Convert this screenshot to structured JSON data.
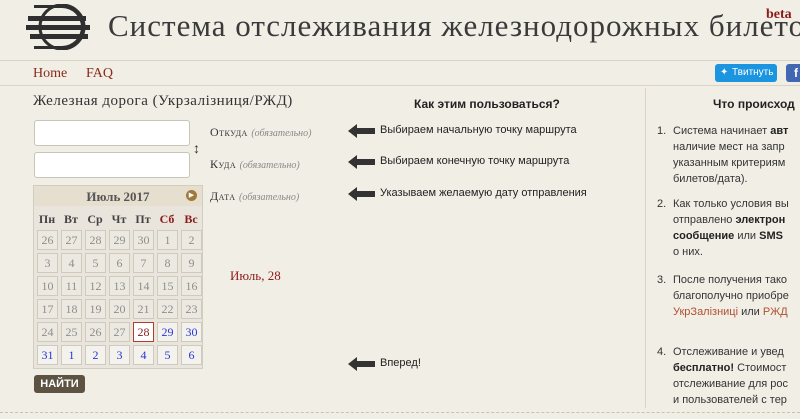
{
  "header": {
    "site_title": "Система отслеживания железнодорожных билетов",
    "beta": "beta"
  },
  "nav": {
    "home": "Home",
    "faq": "FAQ",
    "tweet": "Твитнуть",
    "facebook": "f"
  },
  "form": {
    "railway_title": "Железная дорога (Укрзалізниця/РЖД)",
    "from_value": "",
    "to_value": "",
    "from_label": "Откуда",
    "to_label": "Куда",
    "date_label": "Дата",
    "required": "(обязательно)",
    "selected_date": "Июль, 28",
    "find_button": "НАЙТИ"
  },
  "calendar": {
    "month": "Июль 2017",
    "weekdays": [
      "Пн",
      "Вт",
      "Ср",
      "Чт",
      "Пт",
      "Сб",
      "Вс"
    ],
    "weeks": [
      [
        "26",
        "27",
        "28",
        "29",
        "30",
        "1",
        "2"
      ],
      [
        "3",
        "4",
        "5",
        "6",
        "7",
        "8",
        "9"
      ],
      [
        "10",
        "11",
        "12",
        "13",
        "14",
        "15",
        "16"
      ],
      [
        "17",
        "18",
        "19",
        "20",
        "21",
        "22",
        "23"
      ],
      [
        "24",
        "25",
        "26",
        "27",
        "28",
        "29",
        "30"
      ],
      [
        "31",
        "1",
        "2",
        "3",
        "4",
        "5",
        "6"
      ]
    ],
    "today": "28",
    "available_color": "#2a36d6",
    "today_color": "#8b1a1a"
  },
  "how_to": {
    "heading": "Как этим пользоваться?",
    "hints": [
      "Выбираем начальную точку маршрута",
      "Выбираем конечную точку маршрута",
      "Указываем желаемую дату отправления",
      "Вперед!"
    ]
  },
  "what_happens": {
    "heading": "Что происход",
    "steps": [
      {
        "num": "1.",
        "lines": [
          [
            "Система начинает ",
            "авт"
          ],
          [
            "наличие мест на запр"
          ],
          [
            "указанным критериям"
          ],
          [
            "билетов/дата)."
          ]
        ]
      },
      {
        "num": "2.",
        "lines": [
          [
            "Как только условия вы"
          ],
          [
            "отправлено ",
            "электрон"
          ],
          [
            "сообщение",
            " или ",
            "SMS"
          ],
          [
            "о них."
          ]
        ]
      },
      {
        "num": "3.",
        "lines": [
          [
            "После получения тако"
          ],
          [
            "благополучно приобре"
          ],
          [
            "УкрЗалізниці",
            " или ",
            "РЖД"
          ]
        ]
      },
      {
        "num": "4.",
        "lines": [
          [
            "Отслеживание и увед"
          ],
          [
            "бесплатно!",
            " Стоимост"
          ],
          [
            "отслеживание для рос"
          ],
          [
            "и пользователей с тер"
          ]
        ]
      }
    ]
  },
  "colors": {
    "background": "#f1eee6",
    "link": "#8b2b1b",
    "twitter": "#1b95e0",
    "facebook": "#4267b2",
    "button": "#5e5243"
  }
}
